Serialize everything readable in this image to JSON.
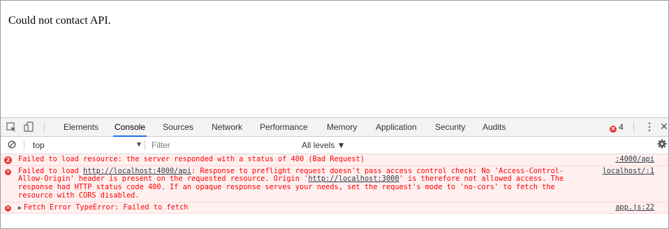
{
  "page": {
    "body_text": "Could not contact API."
  },
  "devtools": {
    "tabs": [
      "Elements",
      "Console",
      "Sources",
      "Network",
      "Performance",
      "Memory",
      "Application",
      "Security",
      "Audits"
    ],
    "active_tab": "Console",
    "error_count": "4",
    "filter_bar": {
      "context": "top",
      "filter_placeholder": "Filter",
      "levels": "All levels ▼"
    },
    "messages": {
      "m1": {
        "count": "2",
        "text": "Failed to load resource: the server responded with a status of 400 (Bad Request)",
        "source": ":4000/api"
      },
      "m2": {
        "pre": "Failed to load ",
        "url1": "http://localhost:4000/api",
        "mid": ": Response to preflight request doesn't pass access control check: No 'Access-Control-Allow-Origin' header is present on the requested resource. Origin '",
        "url2": "http://localhost:3000",
        "post": "' is therefore not allowed access. The response had HTTP status code 400. If an opaque response serves your needs, set the request's mode to 'no-cors' to fetch the resource with CORS disabled.",
        "source": "localhost/:1"
      },
      "m3": {
        "text": "Fetch Error TypeError: Failed to fetch",
        "source": "app.js:22"
      }
    }
  }
}
